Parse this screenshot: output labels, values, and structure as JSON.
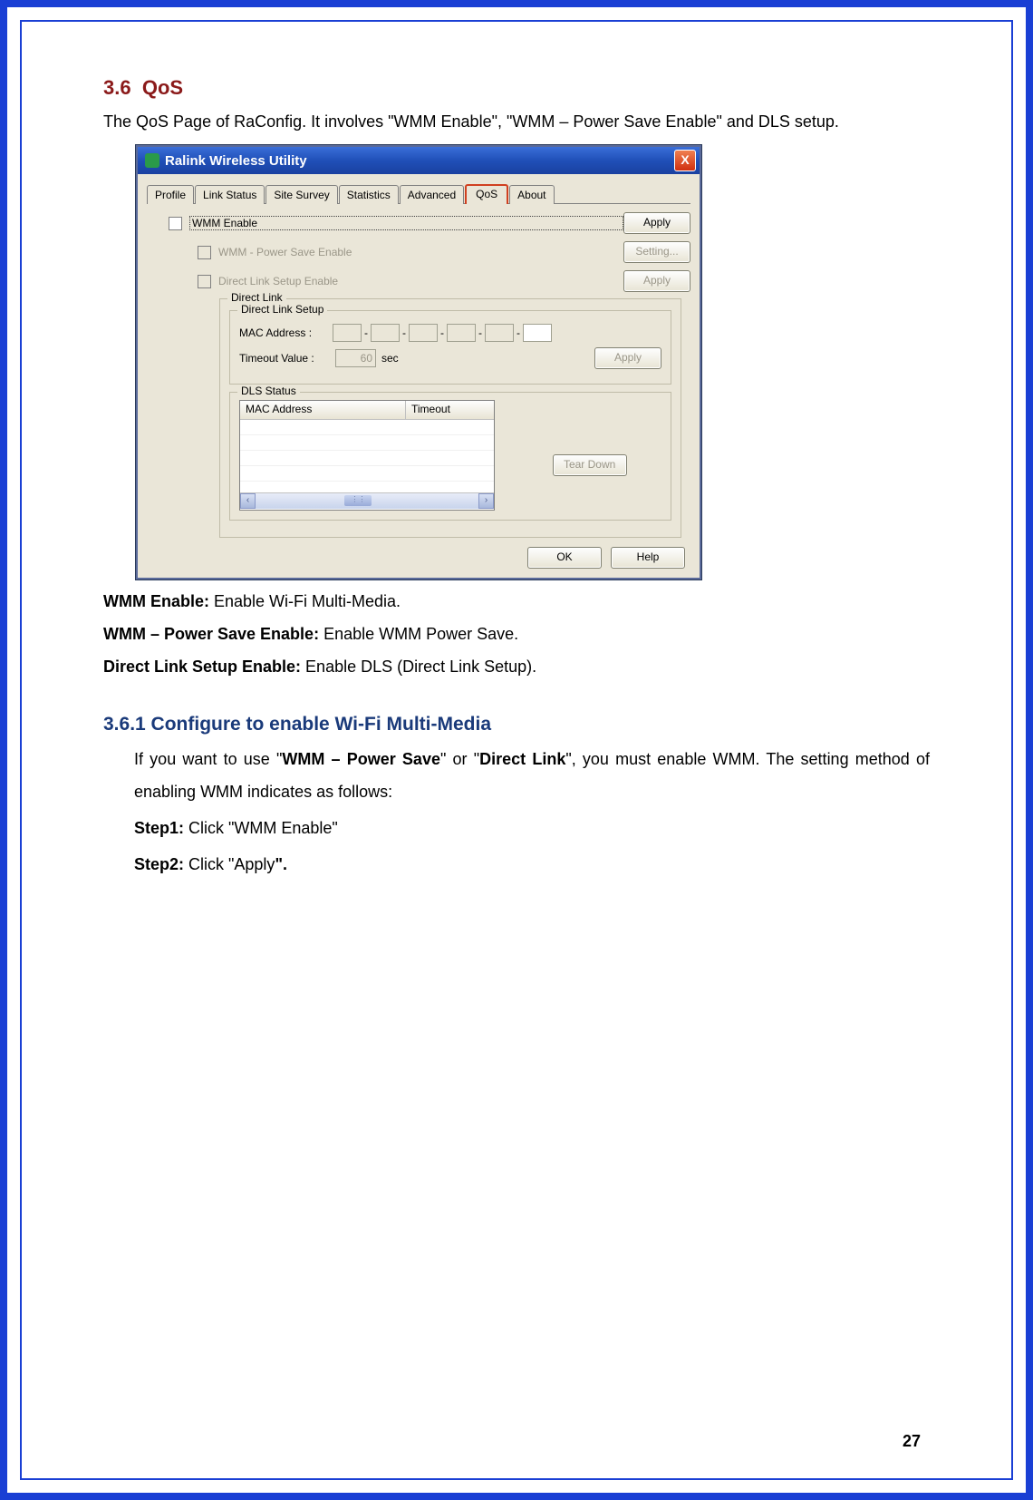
{
  "section": {
    "number": "3.6",
    "title": "QoS",
    "intro": "The QoS Page of RaConfig. It involves \"WMM Enable\", \"WMM – Power Save Enable\" and DLS setup."
  },
  "window": {
    "title": "Ralink Wireless Utility",
    "tabs": [
      "Profile",
      "Link Status",
      "Site Survey",
      "Statistics",
      "Advanced",
      "QoS",
      "About"
    ],
    "active_tab": "QoS",
    "wmm_enable_label": "WMM Enable",
    "wmm_ps_label": "WMM - Power Save Enable",
    "dls_enable_label": "Direct Link Setup Enable",
    "apply_label": "Apply",
    "setting_label": "Setting...",
    "direct_link_legend": "Direct Link",
    "dls_setup_legend": "Direct Link Setup",
    "mac_label": "MAC Address :",
    "timeout_label": "Timeout Value :",
    "timeout_value": "60",
    "timeout_unit": "sec",
    "dls_status_legend": "DLS Status",
    "col_mac": "MAC Address",
    "col_timeout": "Timeout",
    "teardown_label": "Tear Down",
    "ok_label": "OK",
    "help_label": "Help"
  },
  "definitions": {
    "wmm_enable_b": "WMM Enable:",
    "wmm_enable_t": " Enable Wi-Fi Multi-Media.",
    "wmm_ps_b": "WMM – Power Save Enable:",
    "wmm_ps_t": " Enable WMM Power Save.",
    "dls_b": "Direct Link Setup Enable:",
    "dls_t": " Enable DLS (Direct Link Setup)."
  },
  "subsection": {
    "title": "3.6.1 Configure to enable Wi-Fi Multi-Media",
    "intro_pre": "If you want to use \"",
    "intro_b1": "WMM – Power Save",
    "intro_mid": "\" or \"",
    "intro_b2": "Direct Link",
    "intro_post": "\", you must enable WMM. The setting method of enabling WMM indicates as follows:",
    "step1_b": "Step1:",
    "step1_t": " Click \"WMM Enable\"",
    "step2_b": "Step2:",
    "step2_t": " Click \"Apply",
    "step2_end": "\"."
  },
  "page_number": "27"
}
